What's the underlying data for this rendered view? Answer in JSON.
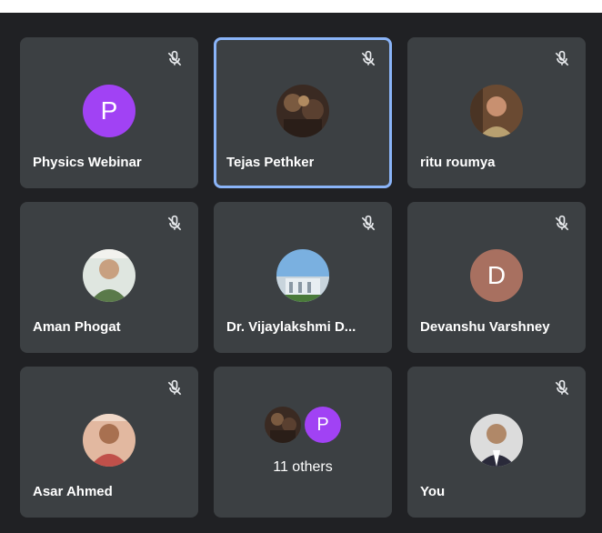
{
  "participants": [
    {
      "name": "Physics Webinar",
      "avatar_letter": "P",
      "avatar_color": "#a142f4",
      "muted": true,
      "active": false
    },
    {
      "name": "Tejas Pethker",
      "avatar_letter": "",
      "avatar_color": "#6b4a3a",
      "muted": true,
      "active": true
    },
    {
      "name": "ritu roumya",
      "avatar_letter": "",
      "avatar_color": "#9c6b4a",
      "muted": true,
      "active": false
    },
    {
      "name": "Aman Phogat",
      "avatar_letter": "",
      "avatar_color": "#6b8c5a",
      "muted": true,
      "active": false
    },
    {
      "name": "Dr. Vijaylakshmi D...",
      "avatar_letter": "",
      "avatar_color": "#4a86c8",
      "muted": true,
      "active": false
    },
    {
      "name": "Devanshu Varshney",
      "avatar_letter": "D",
      "avatar_color": "#a87060",
      "muted": true,
      "active": false
    },
    {
      "name": "Asar Ahmed",
      "avatar_letter": "",
      "avatar_color": "#b4564a",
      "muted": true,
      "active": false
    },
    {
      "name": "You",
      "avatar_letter": "",
      "avatar_color": "#d8d8d8",
      "muted": true,
      "active": false
    }
  ],
  "others": {
    "label": "11 others",
    "avatar_letter": "P",
    "avatar_color": "#a142f4"
  },
  "icons": {
    "mic": "mic-off-icon"
  }
}
